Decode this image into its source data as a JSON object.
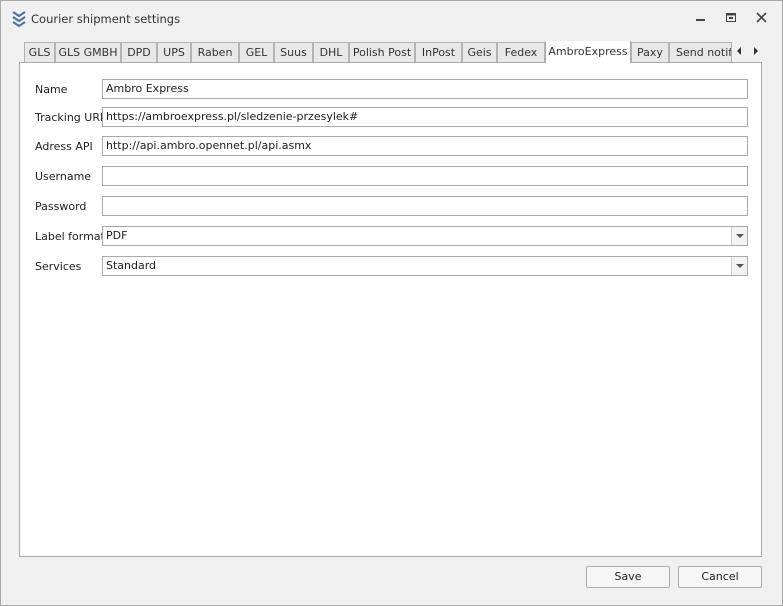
{
  "window": {
    "title": "Courier shipment settings",
    "app_icon": "stacked-chevrons-icon",
    "controls": [
      "minimize-icon",
      "maximize-icon",
      "close-icon"
    ]
  },
  "tabs": [
    {
      "label": "GLS",
      "active": false
    },
    {
      "label": "GLS GMBH",
      "active": false
    },
    {
      "label": "DPD",
      "active": false
    },
    {
      "label": "UPS",
      "active": false
    },
    {
      "label": "Raben",
      "active": false
    },
    {
      "label": "GEL",
      "active": false
    },
    {
      "label": "Suus",
      "active": false
    },
    {
      "label": "DHL",
      "active": false
    },
    {
      "label": "Polish Post",
      "active": false
    },
    {
      "label": "InPost",
      "active": false
    },
    {
      "label": "Geis",
      "active": false
    },
    {
      "label": "Fedex",
      "active": false
    },
    {
      "label": "AmbroExpress",
      "active": true
    },
    {
      "label": "Paxy",
      "active": false
    },
    {
      "label": "Send notifi",
      "active": false
    }
  ],
  "form": {
    "name": {
      "label": "Name",
      "value": "Ambro Express"
    },
    "tracking_url": {
      "label": "Tracking URL",
      "value": "https://ambroexpress.pl/sledzenie-przesylek#"
    },
    "address_api": {
      "label": "Adress API",
      "value": "http://api.ambro.opennet.pl/api.asmx"
    },
    "username": {
      "label": "Username",
      "value": ""
    },
    "password": {
      "label": "Password",
      "value": ""
    },
    "label_format": {
      "label": "Label format",
      "value": "PDF"
    },
    "services": {
      "label": "Services",
      "value": "Standard"
    }
  },
  "buttons": {
    "save": "Save",
    "cancel": "Cancel"
  },
  "colors": {
    "window_bg": "#f0f0f0",
    "panel_bg": "#ffffff",
    "border": "#a9a9a9",
    "icon_blue": "#4a6fa5"
  }
}
